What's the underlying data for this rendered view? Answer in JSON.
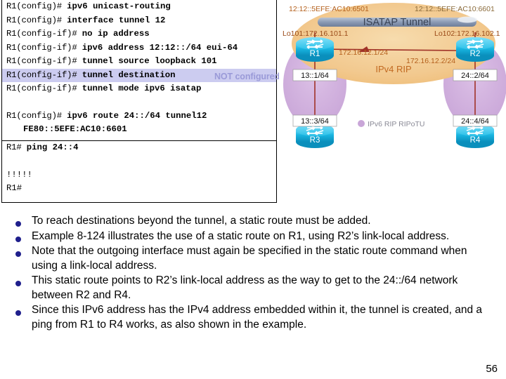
{
  "slide": {
    "page_number": "56"
  },
  "terminal": {
    "config_block": {
      "lines": [
        {
          "prompt": "R1(config)# ",
          "command": "ipv6 unicast-routing",
          "highlight": false
        },
        {
          "prompt": "R1(config)# ",
          "command": "interface tunnel 12",
          "highlight": false
        },
        {
          "prompt": "R1(config-if)# ",
          "command": "no ip address",
          "highlight": false
        },
        {
          "prompt": "R1(config-if)# ",
          "command": "ipv6 address 12:12::/64 eui-64",
          "highlight": false
        },
        {
          "prompt": "R1(config-if)# ",
          "command": "tunnel source loopback 101",
          "highlight": false
        },
        {
          "prompt": "R1(config-if)# ",
          "command": "tunnel destination",
          "highlight": true
        },
        {
          "prompt": "R1(config-if)# ",
          "command": "tunnel mode ipv6 isatap",
          "highlight": false
        }
      ],
      "route_line": {
        "prompt": "R1(config)# ",
        "command": "ipv6 route 24::/64 tunnel12"
      },
      "route_continuation": "FE80::5EFE:AC10:6601",
      "annotation": "NOT configured",
      "annotation_color": "#9a9ad8",
      "highlight_color": "#ccccf0"
    },
    "exec_block": {
      "lines": [
        {
          "prompt": "R1# ",
          "command": "ping 24::4",
          "highlight": false
        }
      ],
      "output": "!!!!!",
      "final_prompt": "R1#"
    }
  },
  "diagram": {
    "title": "ISATAP Tunnel",
    "tunnel_label": "ISATAP Tunnel",
    "cloud_label": "IPv4 RIP",
    "legend": {
      "label": "IPv6 RIP RIPoTU",
      "color": "#c9a6d8"
    },
    "routers": [
      {
        "name": "R1"
      },
      {
        "name": "R2"
      },
      {
        "name": "R3"
      },
      {
        "name": "R4"
      }
    ],
    "labels": {
      "tunnel_addr_left": "12:12::5EFE:AC10:6501",
      "tunnel_addr_right": "12:12::5EFE:AC10:6601",
      "loopback_left": "Lo101:172.16.101.1",
      "loopback_right": "Lo102:172.16.102.1",
      "wan_left": "172.16.12.1/24",
      "wan_right": "172.16.12.2/24",
      "lan_r1": "13::1/64",
      "lan_r3": "13::3/64",
      "lan_r2": "24::2/64",
      "lan_r4": "24::4/64"
    },
    "colors": {
      "cloud_ipv4": "#f2c891",
      "cloud_ipv6": "#cdaad8",
      "tunnel_bar": "#8d9cb5",
      "router_body": "#18b4e0",
      "link": "#a03228",
      "text_orange": "#d2691e"
    }
  },
  "bullets": [
    "To reach destinations beyond the tunnel, a static route must be added.",
    "Example 8-124 illustrates the use of a static route on R1, using R2’s link-local address.",
    "Note that the outgoing interface must again be specified in the static route command when using a link-local address.",
    "This static route points to R2’s link-local address as the way to get to the 24::/64 network between R2 and R4.",
    "Since this IPv6 address has the IPv4 address embedded within it, the tunnel is created, and a ping from R1 to R4 works, as also shown in the example."
  ]
}
